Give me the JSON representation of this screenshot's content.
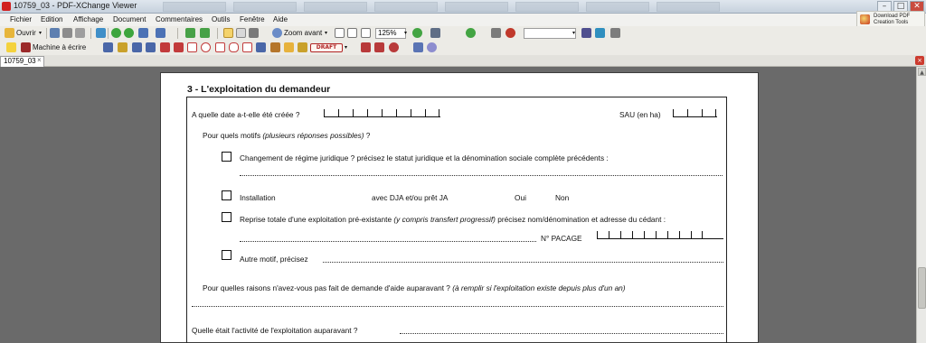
{
  "window": {
    "title": "10759_03 - PDF-XChange Viewer",
    "minimize": "–",
    "maximize": "□",
    "close": "✕"
  },
  "menu": [
    "Fichier",
    "Edition",
    "Affichage",
    "Document",
    "Commentaires",
    "Outils",
    "Fenêtre",
    "Aide"
  ],
  "promo": {
    "line1": "Download PDF",
    "line2": "Creation Tools"
  },
  "toolbar1": {
    "open_label": "Ouvrir",
    "zoom_in_label": "Zoom avant",
    "zoom_value": "125%"
  },
  "toolbar2": {
    "typewriter_label": "Machine à écrire",
    "stamp_label": "DRAFT"
  },
  "tab": {
    "label": "10759_03",
    "close": "×"
  },
  "form": {
    "heading": "3 - L'exploitation du demandeur",
    "date_question": "A quelle date a-t-elle été créée ?",
    "sau_label": "SAU (en ha)",
    "motives_question": "Pour quels motifs",
    "motives_hint": "(plusieurs réponses possibles)",
    "motives_end": " ?",
    "option_legal": "Changement de régime juridique ? précisez le statut juridique et la dénomination sociale complète précédents :",
    "option_install": "Installation",
    "option_install_dja": "avec DJA et/ou prêt JA",
    "yes": "Oui",
    "no": "Non",
    "option_takeover_a": "Reprise totale d'une exploitation pré-existante",
    "option_takeover_hint": "(y compris transfert progressif)",
    "option_takeover_b": " précisez nom/dénomination et adresse du cédant :",
    "pacage_label": "N° PACAGE",
    "option_other": "Autre motif, précisez",
    "no_aid_question": "Pour quelles raisons n'avez-vous pas fait de demande d'aide auparavant ?",
    "no_aid_hint": "(à remplir si l'exploitation existe depuis plus d'un an)",
    "previous_activity": "Quelle était l'activité de l'exploitation auparavant ?"
  }
}
